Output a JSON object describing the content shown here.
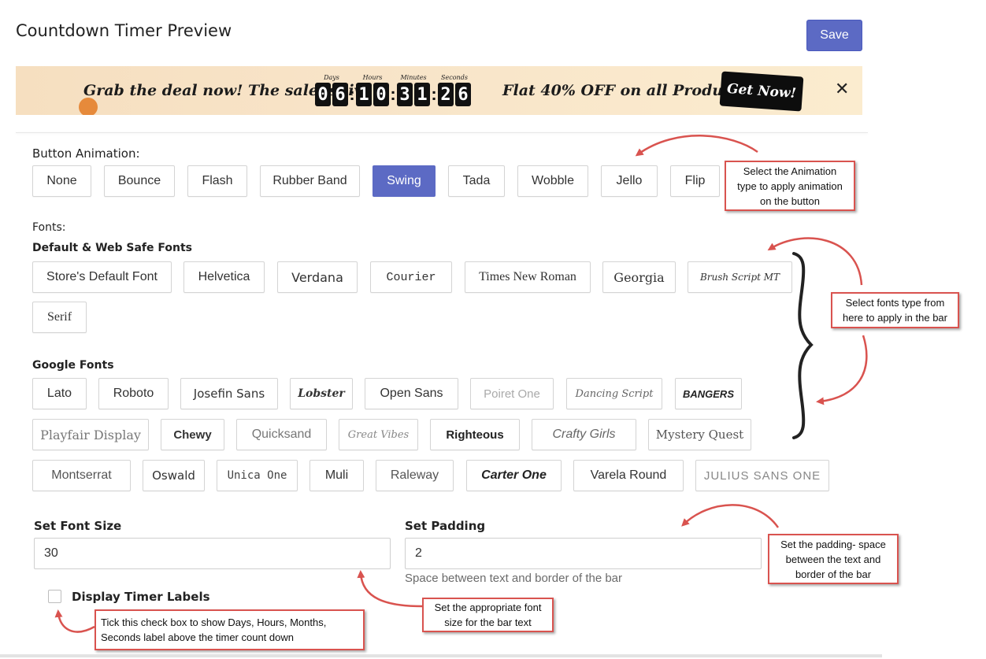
{
  "header": {
    "title": "Countdown Timer Preview",
    "save_label": "Save"
  },
  "preview_bar": {
    "text_left": "Grab the deal now! The sale is live",
    "text_right": "Flat 40% OFF on all Products",
    "timer": {
      "days_label": "Days",
      "hours_label": "Hours",
      "minutes_label": "Minutes",
      "seconds_label": "Seconds",
      "days": [
        "0",
        "6"
      ],
      "hours": [
        "1",
        "0"
      ],
      "minutes": [
        "3",
        "1"
      ],
      "seconds": [
        "2",
        "6"
      ],
      "separator": ":"
    },
    "button_label": "Get Now!",
    "close_symbol": "✕",
    "colors": {
      "background": "#f8e4c8",
      "digit_bg": "#111111",
      "button_bg": "#0d0d0d"
    }
  },
  "animation": {
    "label": "Button Animation:",
    "options": [
      "None",
      "Bounce",
      "Flash",
      "Rubber Band",
      "Swing",
      "Tada",
      "Wobble",
      "Jello",
      "Flip"
    ],
    "selected": "Swing"
  },
  "fonts": {
    "label": "Fonts:",
    "web_safe_label": "Default & Web Safe Fonts",
    "web_safe": [
      "Store's Default Font",
      "Helvetica",
      "Verdana",
      "Courier",
      "Times New Roman",
      "Georgia",
      "Brush Script MT",
      "Serif"
    ],
    "google_label": "Google Fonts",
    "google": [
      "Lato",
      "Roboto",
      "Josefin Sans",
      "Lobster",
      "Open Sans",
      "Poiret One",
      "Dancing Script",
      "BANGERS",
      "Playfair Display",
      "Chewy",
      "Quicksand",
      "Great Vibes",
      "Righteous",
      "Crafty Girls",
      "Mystery Quest",
      "Montserrat",
      "Oswald",
      "Unica One",
      "Muli",
      "Raleway",
      "Carter One",
      "Varela Round",
      "JULIUS SANS ONE"
    ]
  },
  "font_size": {
    "label": "Set Font Size",
    "value": "30"
  },
  "padding": {
    "label": "Set Padding",
    "value": "2",
    "hint": "Space between text and border of the bar"
  },
  "timer_labels": {
    "label": "Display Timer Labels",
    "checked": false
  },
  "callouts": {
    "animation": [
      "Select the Animation",
      "type to apply animation",
      "on the button"
    ],
    "fonts": [
      "Select fonts type from",
      "here to apply in the bar"
    ],
    "padding": [
      "Set the padding- space",
      "between the text and",
      "border of the bar"
    ],
    "font_size": [
      "Set the appropriate font",
      "size for the bar text"
    ],
    "checkbox": [
      "Tick this check box to show Days, Hours, Months,",
      "Seconds label above the timer count down"
    ]
  },
  "accent_color": "#5c6ac4",
  "callout_border_color": "#d9534f"
}
